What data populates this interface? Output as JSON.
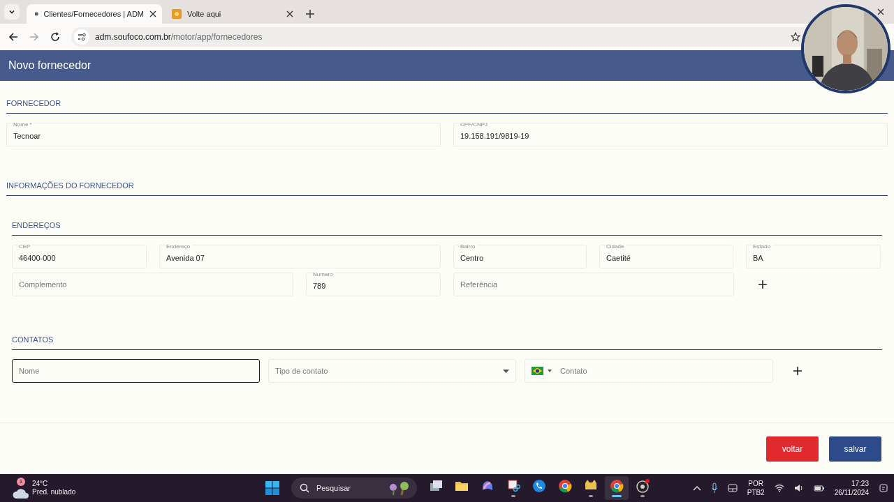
{
  "browser": {
    "tabs": [
      {
        "title": "Clientes/Fornecedores | ADM",
        "selected": true
      },
      {
        "title": "Volte aqui",
        "selected": false
      }
    ],
    "address": {
      "host": "adm.soufoco.com.br",
      "path": "/motor/app/fornecedores"
    }
  },
  "header": {
    "title": "Novo fornecedor"
  },
  "fornecedor": {
    "heading": "FORNECEDOR",
    "fields": [
      {
        "kind": "text",
        "label": "Nome *",
        "value": "Tecnoar"
      },
      {
        "kind": "text",
        "label": "CPF/CNPJ",
        "value": "19.158.191/9819-19"
      }
    ]
  },
  "informacoes": {
    "heading": "INFORMAÇÕES DO FORNECEDOR",
    "enderecos": {
      "heading": "ENDEREÇOS",
      "rows": [
        [
          {
            "kind": "text",
            "label": "CEP",
            "value": "46400-000"
          },
          {
            "kind": "text",
            "label": "Endereço",
            "value": "Avenida 07"
          },
          {
            "kind": "text",
            "label": "Bairro",
            "value": "Centro"
          },
          {
            "kind": "text",
            "label": "Cidade",
            "value": "Caetité"
          },
          {
            "kind": "text",
            "label": "Estado",
            "value": "BA"
          }
        ],
        [
          {
            "kind": "text",
            "placeholder": "Complemento"
          },
          {
            "kind": "text",
            "label": "Numero",
            "value": "789"
          },
          {
            "kind": "text",
            "placeholder": "Referência"
          }
        ]
      ]
    },
    "contatos": {
      "heading": "CONTATOS",
      "fields": [
        {
          "kind": "text",
          "placeholder": "Nome",
          "focused": true
        },
        {
          "kind": "select",
          "placeholder": "Tipo de contato",
          "focused": false
        },
        {
          "kind": "phone",
          "placeholder": "Contato",
          "focused": false
        }
      ]
    }
  },
  "actions": [
    {
      "label": "voltar",
      "kind": "danger"
    },
    {
      "label": "salvar",
      "kind": "primary"
    }
  ],
  "taskbar": {
    "weather": {
      "badge": "1",
      "temperature": "24°C",
      "condition": "Pred. nublado"
    },
    "search": {
      "placeholder": "Pesquisar"
    },
    "apps": [
      {
        "kind": "taskview",
        "running": false,
        "selected": false
      },
      {
        "kind": "folder",
        "running": false,
        "selected": false
      },
      {
        "kind": "copilot",
        "running": false,
        "selected": false
      },
      {
        "kind": "snip",
        "running": true,
        "selected": false
      },
      {
        "kind": "phone",
        "running": false,
        "selected": false
      },
      {
        "kind": "chrome",
        "running": false,
        "selected": false
      },
      {
        "kind": "cat",
        "running": true,
        "selected": false
      },
      {
        "kind": "chrome-dev",
        "running": true,
        "selected": true
      },
      {
        "kind": "obs",
        "running": true,
        "selected": false
      }
    ],
    "language": {
      "line_1": "POR",
      "line_2": "PTB2"
    },
    "clock": {
      "time": "17:23",
      "date": "26/11/2024"
    }
  }
}
